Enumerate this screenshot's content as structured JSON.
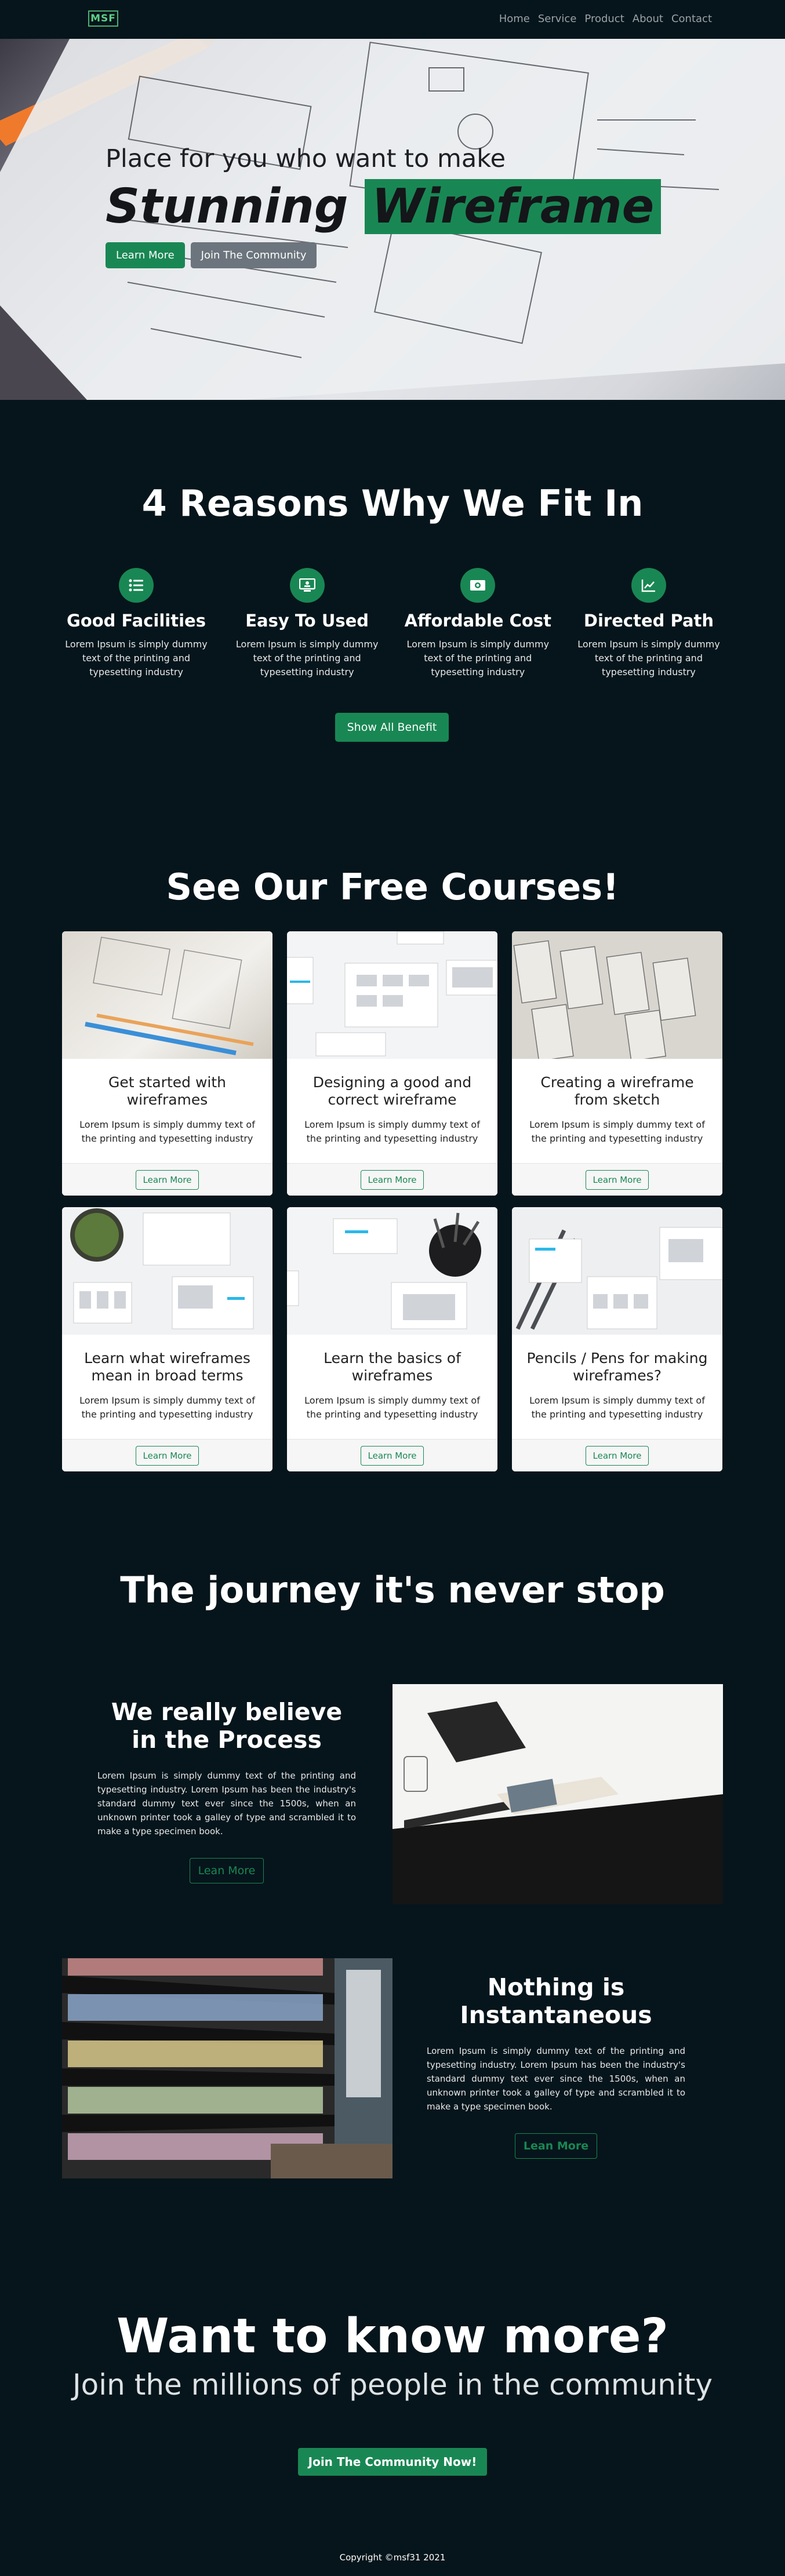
{
  "nav": {
    "logo": "MSF",
    "links": [
      "Home",
      "Service",
      "Product",
      "About",
      "Contact"
    ]
  },
  "hero": {
    "subtitle": "Place for you who want to make",
    "title_plain": "Stunning",
    "title_highlight": "Wireframe",
    "learn_more": "Learn More",
    "join": "Join The Community"
  },
  "reasons": {
    "heading": "4 Reasons Why We Fit In",
    "items": [
      {
        "title": "Good Facilities",
        "text": "Lorem Ipsum is simply dummy text of the printing and typesetting industry",
        "icon": "list-icon"
      },
      {
        "title": "Easy To Used",
        "text": "Lorem Ipsum is simply dummy text of the printing and typesetting industry",
        "icon": "screen-icon"
      },
      {
        "title": "Affordable Cost",
        "text": "Lorem Ipsum is simply dummy text of the printing and typesetting industry",
        "icon": "money-icon"
      },
      {
        "title": "Directed Path",
        "text": "Lorem Ipsum is simply dummy text of the printing and typesetting industry",
        "icon": "chart-line-icon"
      }
    ],
    "button": "Show All Benefit"
  },
  "courses": {
    "heading": "See Our Free Courses!",
    "items": [
      {
        "title": "Get started with wireframes",
        "text": "Lorem Ipsum is simply dummy text of the printing and typesetting industry",
        "button": "Learn More"
      },
      {
        "title": "Designing a good and correct wireframe",
        "text": "Lorem Ipsum is simply dummy text of the printing and typesetting industry",
        "button": "Learn More"
      },
      {
        "title": "Creating a wireframe from sketch",
        "text": "Lorem Ipsum is simply dummy text of the printing and typesetting industry",
        "button": "Learn More"
      },
      {
        "title": "Learn what wireframes mean in broad terms",
        "text": "Lorem Ipsum is simply dummy text of the printing and typesetting industry",
        "button": "Learn More"
      },
      {
        "title": "Learn the basics of wireframes",
        "text": "Lorem Ipsum is simply dummy text of the printing and typesetting industry",
        "button": "Learn More"
      },
      {
        "title": "Pencils / Pens for making wireframes?",
        "text": "Lorem Ipsum is simply dummy text of the printing and typesetting industry",
        "button": "Learn More"
      }
    ]
  },
  "journey": {
    "heading": "The journey it's never stop",
    "block1": {
      "title": "We really believe in the Process",
      "text": "Lorem Ipsum is simply dummy text of the printing and typesetting industry. Lorem Ipsum has been the industry's standard dummy text ever since the 1500s, when an unknown printer took a galley of type and scrambled it to make a type specimen book.",
      "button": "Lean More"
    },
    "block2": {
      "title": "Nothing is Instantaneous",
      "text": "Lorem Ipsum is simply dummy text of the printing and typesetting industry. Lorem Ipsum has been the industry's standard dummy text ever since the 1500s, when an unknown printer took a galley of type and scrambled it to make a type specimen book.",
      "button": "Lean More"
    }
  },
  "cta": {
    "heading": "Want to know more?",
    "subtitle": "Join the millions of people in the community",
    "button": "Join The Community Now!"
  },
  "footer": {
    "copyright": "Copyright ©msf31 2021"
  },
  "colors": {
    "background": "#06151b",
    "accent": "#198754"
  }
}
